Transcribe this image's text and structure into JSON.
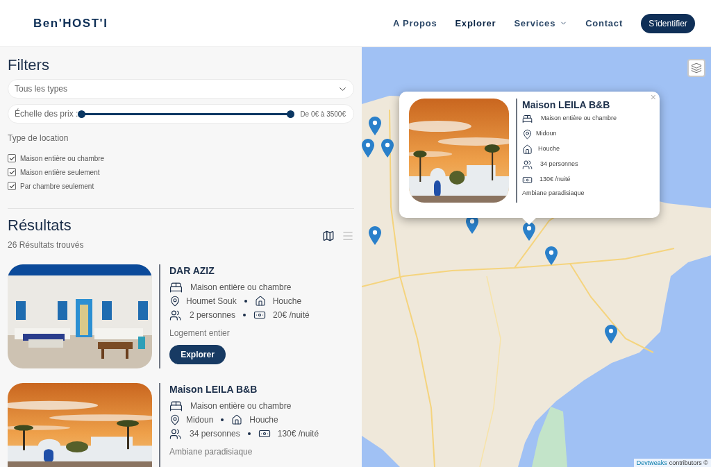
{
  "header": {
    "logo": "Ben'HOST'I",
    "nav": [
      {
        "label": "A Propos",
        "selected": false,
        "kind": "link"
      },
      {
        "label": "Explorer",
        "selected": true,
        "kind": "link"
      },
      {
        "label": "Services",
        "selected": false,
        "kind": "dropdown"
      },
      {
        "label": "Contact",
        "selected": false,
        "kind": "link"
      }
    ],
    "login_button": "S'identifier"
  },
  "filters": {
    "title": "Filters",
    "type_select": {
      "value": "Tous les types"
    },
    "price_range": {
      "label": "Échelle des prix :",
      "thumbs": [
        {
          "level": 0
        },
        {
          "level": 1
        }
      ],
      "reading": "De 0€ à 3500€"
    },
    "rental_type": {
      "label": "Type de location",
      "options": [
        {
          "label": "Maison entière ou chambre",
          "checked": true
        },
        {
          "label": "Maison entière seulement",
          "checked": true
        },
        {
          "label": "Par chambre seulement",
          "checked": true
        }
      ]
    }
  },
  "results": {
    "title": "Résultats",
    "count": "26 Résultats trouvés",
    "views": [
      {
        "kind": "map",
        "selected": true
      },
      {
        "kind": "list",
        "selected": false
      }
    ],
    "listings": [
      {
        "photo": {
          "kind": "white-house"
        },
        "name": "DAR AZIZ",
        "type": "Maison entière ou chambre",
        "location": "Houmet Souk",
        "category": "Houche",
        "guests": "2 personnes",
        "price": "20€ /nuité",
        "note": "Logement entier",
        "button": "Explorer"
      },
      {
        "photo": {
          "kind": "sunset"
        },
        "name": "Maison LEILA B&B",
        "type": "Maison entière ou chambre",
        "location": "Midoun",
        "category": "Houche",
        "guests": "34 personnes",
        "price": "130€ /nuité",
        "note": "Ambiane paradisiaque"
      }
    ]
  },
  "map": {
    "popup": {
      "photo": {
        "kind": "sunset"
      },
      "name": "Maison LEILA B&B",
      "type": "Maison entière ou chambre",
      "location": "Midoun",
      "category": "Houche",
      "guests": "34 personnes",
      "price": "130€ /nuité",
      "note": "Ambiane paradisiaque",
      "close": "×"
    },
    "attribution": {
      "link": "Devtweaks",
      "text": "contributors ©"
    }
  }
}
